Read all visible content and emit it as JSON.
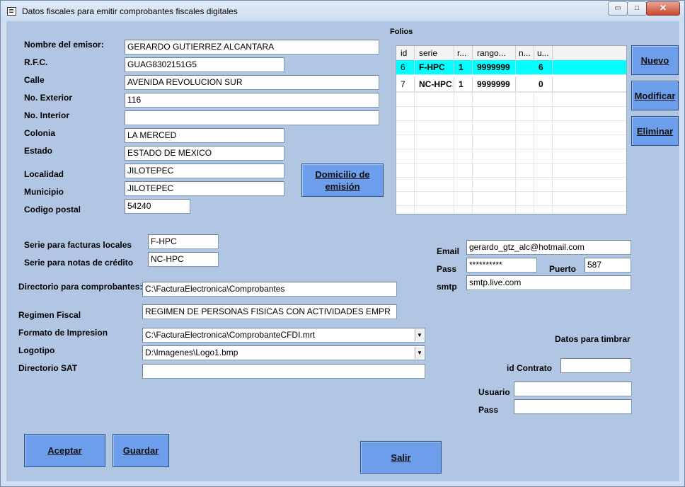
{
  "window": {
    "title": "Datos fiscales para emitir comprobantes fiscales digitales"
  },
  "controls": {
    "minimize": "▭",
    "maximize": "□",
    "close": "✕"
  },
  "emisor": {
    "nombre_label": "Nombre del emisor:",
    "nombre": "GERARDO GUTIERREZ ALCANTARA",
    "rfc_label": "R.F.C.",
    "rfc": "GUAG8302151G5",
    "calle_label": "Calle",
    "calle": "AVENIDA REVOLUCION SUR",
    "no_exterior_label": "No. Exterior",
    "no_exterior": "116",
    "no_interior_label": "No. Interior",
    "no_interior": "",
    "colonia_label": "Colonia",
    "colonia": "LA MERCED",
    "estado_label": "Estado",
    "estado": "ESTADO DE MEXICO",
    "localidad_label": "Localidad",
    "localidad": "JILOTEPEC",
    "municipio_label": "Municipio",
    "municipio": "JILOTEPEC",
    "cp_label": "Codigo postal",
    "cp": "54240"
  },
  "domicilio_button": {
    "line1": "Domicilio de",
    "line2": "emisión"
  },
  "folios": {
    "label": "Folios",
    "columns": [
      "id",
      "serie",
      "r...",
      "rango...",
      "n...",
      "u..."
    ],
    "rows": [
      [
        "6",
        "F-HPC",
        "1",
        "9999999",
        "",
        "6"
      ],
      [
        "7",
        "NC-HPC",
        "1",
        "9999999",
        "",
        "0"
      ]
    ]
  },
  "side_buttons": {
    "nuevo": "Nuevo",
    "modificar": "Modificar",
    "eliminar": "Eliminar"
  },
  "series": {
    "facturas_label": "Serie para facturas locales",
    "facturas": "F-HPC",
    "notas_label": "Serie para notas de crédito",
    "notas": "NC-HPC"
  },
  "email": {
    "email_label": "Email",
    "email": "gerardo_gtz_alc@hotmail.com",
    "pass_label": "Pass",
    "pass": "**********",
    "puerto_label": "Puerto",
    "puerto": "587",
    "smtp_label": "smtp",
    "smtp": "smtp.live.com"
  },
  "config": {
    "directorio_label": "Directorio para comprobantes:",
    "directorio": "C:\\FacturaElectronica\\Comprobantes",
    "regimen_label": "Regimen Fiscal",
    "regimen": "REGIMEN DE PERSONAS FISICAS CON ACTIVIDADES EMPR",
    "formato_label": "Formato de Impresion",
    "formato": "C:\\FacturaElectronica\\ComprobanteCFDI.mrt",
    "logotipo_label": "Logotipo",
    "logotipo": "D:\\Imagenes\\Logo1.bmp",
    "sat_label": "Directorio SAT",
    "sat": ""
  },
  "timbrar": {
    "title": "Datos para timbrar",
    "contrato_label": "id Contrato",
    "contrato": "",
    "usuario_label": "Usuario",
    "usuario": "",
    "pass_label": "Pass",
    "pass": ""
  },
  "bottom_buttons": {
    "aceptar": "Aceptar",
    "guardar": "Guardar",
    "salir": "Salir"
  },
  "colors": {
    "client_bg": "#b1c6e3",
    "button_bg": "#6d9eeb",
    "selected_row": "#00ffff"
  }
}
